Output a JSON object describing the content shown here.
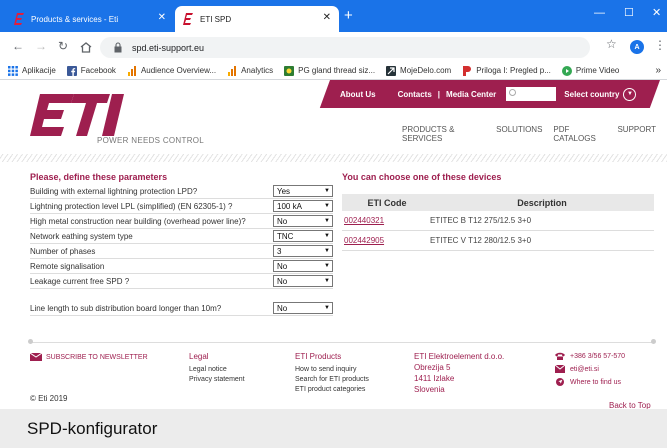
{
  "browser": {
    "tabs": [
      {
        "title": "Products & services - Eti",
        "active": false
      },
      {
        "title": "ETI SPD",
        "active": true
      }
    ],
    "url": "spd.eti-support.eu",
    "avatar_letter": "A",
    "bookmarks": [
      {
        "label": "Aplikacije",
        "icon": "apps-grid-icon"
      },
      {
        "label": "Facebook",
        "icon": "facebook-icon"
      },
      {
        "label": "Audience Overview...",
        "icon": "analytics-icon"
      },
      {
        "label": "Analytics",
        "icon": "analytics-icon"
      },
      {
        "label": "PG gland thread siz...",
        "icon": "bookmark-favicon"
      },
      {
        "label": "MojeDelo.com",
        "icon": "bookmark-favicon"
      },
      {
        "label": "Priloga I: Pregled p...",
        "icon": "bookmark-favicon"
      },
      {
        "label": "Prime Video",
        "icon": "play-icon"
      }
    ],
    "bookmarks_more": "»"
  },
  "site": {
    "logo_tagline": "POWER NEEDS CONTROL",
    "topnav": {
      "about": "About Us",
      "contacts": "Contacts",
      "separator": "|",
      "media": "Media Center",
      "select_country": "Select country"
    },
    "mainnav": [
      "PRODUCTS & SERVICES",
      "SOLUTIONS",
      "PDF CATALOGS",
      "SUPPORT"
    ]
  },
  "params": {
    "title": "Please, define these parameters",
    "rows": [
      {
        "label": "Building with external lightning protection LPD?",
        "value": "Yes"
      },
      {
        "label": "Lightning protection level LPL (simplified) (EN 62305-1) ?",
        "value": "100 kA"
      },
      {
        "label": "High metal construction near building (overhead power line)?",
        "value": "No"
      },
      {
        "label": "Network eathing system type",
        "value": "TNC"
      },
      {
        "label": "Number of phases",
        "value": "3"
      },
      {
        "label": "Remote signalisation",
        "value": "No"
      },
      {
        "label": "Leakage current free SPD ?",
        "value": "No"
      }
    ],
    "extra_row": {
      "label": "Line length to sub distribution board longer than 10m?",
      "value": "No"
    }
  },
  "devices": {
    "title": "You can choose one of these devices",
    "headers": [
      "ETI Code",
      "Description"
    ],
    "rows": [
      {
        "code": "002440321",
        "description": "ETITEC B T12 275/12.5 3+0"
      },
      {
        "code": "002442905",
        "description": "ETITEC V T12 280/12.5 3+0"
      }
    ]
  },
  "footer": {
    "newsletter": "SUBSCRIBE TO NEWSLETTER",
    "legal": {
      "title": "Legal",
      "items": [
        "Legal notice",
        "Privacy statement"
      ]
    },
    "products": {
      "title": "ETI Products",
      "items": [
        "How to send inquiry",
        "Search for ETI products",
        "ETI product categories"
      ]
    },
    "address": [
      "ETI Elektroelement d.o.o.",
      "Obrezija 5",
      "1411 Izlake",
      "Slovenia"
    ],
    "contact": {
      "phone": "+386 3/56 57-570",
      "email": "eti@eti.si",
      "find": "Where to find us"
    },
    "copyright": "© Eti 2019",
    "back_to_top": "Back to Top"
  },
  "caption": "SPD-konfigurator",
  "colors": {
    "accent": "#9e1f4f",
    "chrome": "#1a73e8"
  }
}
